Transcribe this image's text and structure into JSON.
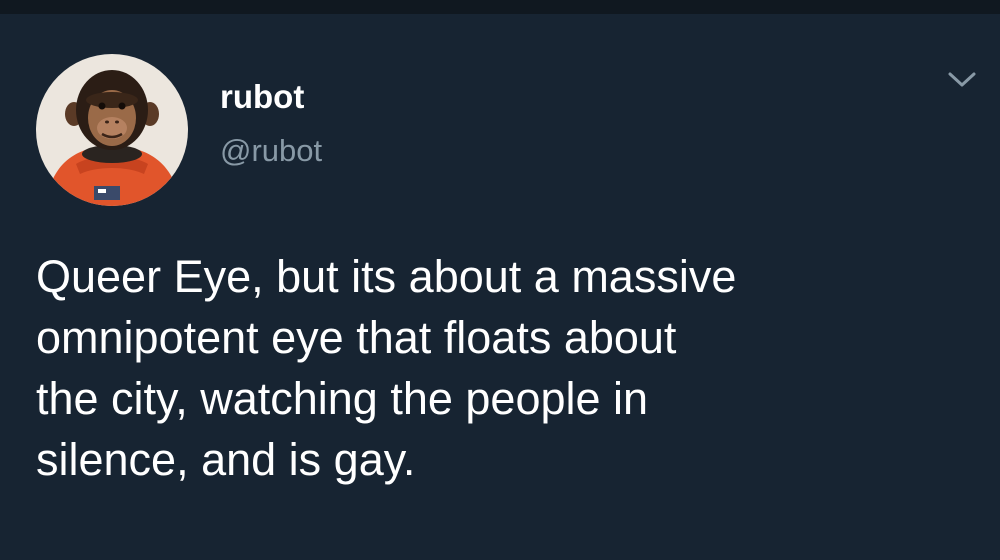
{
  "tweet": {
    "author": {
      "display_name": "rubot",
      "handle": "@rubot",
      "avatar": "chimpanzee-astronaut-avatar"
    },
    "menu_icon": "chevron-down-icon",
    "text_lines": [
      "Queer Eye, but its about a massive",
      "omnipotent eye that floats about",
      "the city, watching the people in",
      "silence, and is gay."
    ]
  },
  "colors": {
    "background": "#172432",
    "text": "#ffffff",
    "secondary_text": "#8899a6"
  }
}
